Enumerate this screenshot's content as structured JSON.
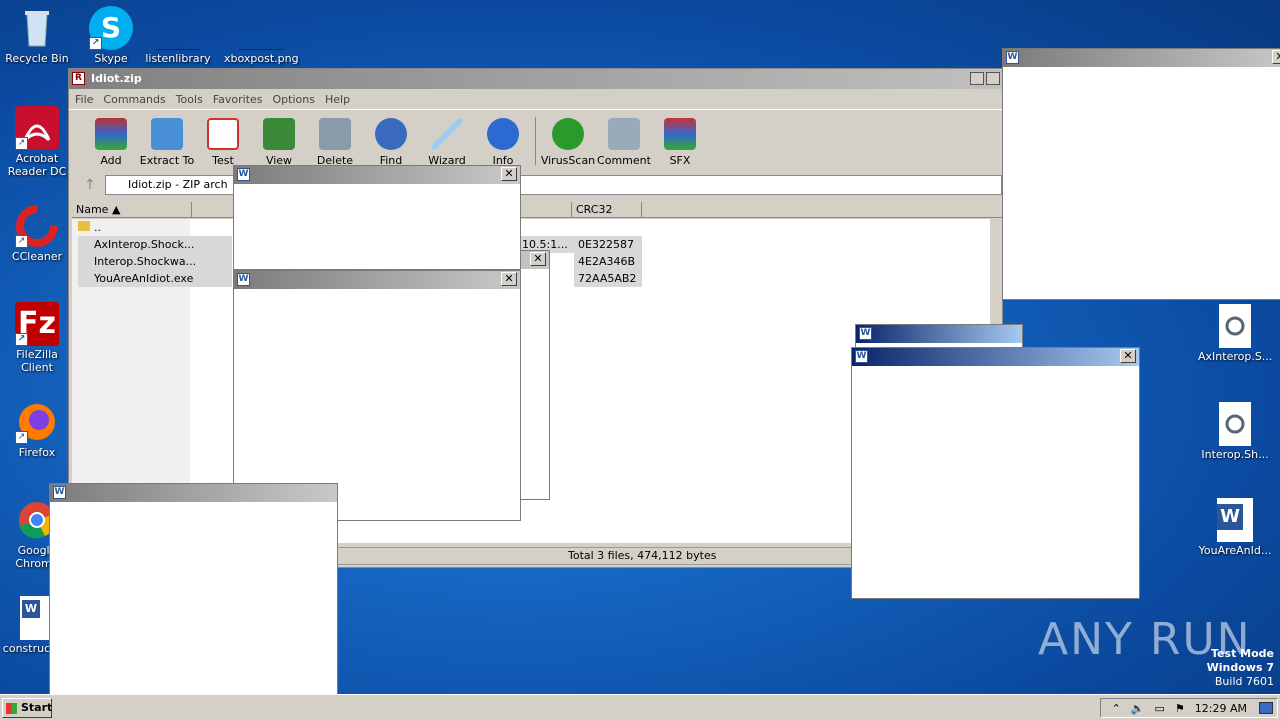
{
  "desktop": {
    "icons_left": [
      {
        "label": "Recycle Bin",
        "icon": "recycle-bin-icon"
      },
      {
        "label": "Acrobat Reader DC",
        "icon": "acrobat-icon"
      },
      {
        "label": "CCleaner",
        "icon": "ccleaner-icon"
      },
      {
        "label": "FileZilla Client",
        "icon": "filezilla-icon"
      },
      {
        "label": "Firefox",
        "icon": "firefox-icon"
      },
      {
        "label": "Google Chrome",
        "icon": "chrome-icon"
      },
      {
        "label": "construction",
        "icon": "word-doc-icon"
      }
    ],
    "icons_top": [
      {
        "label": "Skype",
        "icon": "skype-icon"
      },
      {
        "label": "listenlibrary",
        "icon": "file-icon"
      },
      {
        "label": "xboxpost.png",
        "icon": "image-icon"
      }
    ],
    "icons_right": [
      {
        "label": "AxInterop.S...",
        "icon": "dll-icon"
      },
      {
        "label": "Interop.Sh...",
        "icon": "dll-icon"
      },
      {
        "label": "YouAreAnId...",
        "icon": "word-icon"
      }
    ]
  },
  "winrar": {
    "title": "Idiot.zip",
    "menu": [
      "File",
      "Commands",
      "Tools",
      "Favorites",
      "Options",
      "Help"
    ],
    "toolbar": [
      "Add",
      "Extract To",
      "Test",
      "View",
      "Delete",
      "Find",
      "Wizard",
      "Info",
      "VirusScan",
      "Comment",
      "SFX"
    ],
    "address": "Idiot.zip - ZIP arch",
    "columns": [
      "Name",
      "CRC32"
    ],
    "rows": [
      {
        "name": "..",
        "modified": "",
        "crc": ""
      },
      {
        "name": "AxInterop.Shock...",
        "modified": "10.5:1...",
        "crc": "0E322587"
      },
      {
        "name": "Interop.Shockwa...",
        "modified": "",
        "crc": "4E2A346B"
      },
      {
        "name": "YouAreAnIdiot.exe",
        "modified": "",
        "crc": "72AA5AB2"
      }
    ],
    "status": "Total 3 files, 474,112 bytes"
  },
  "popup_close": "✕",
  "taskbar": {
    "start": "Start",
    "clock": "12:29 AM"
  },
  "watermark": {
    "line1": "Test Mode",
    "line2": "Windows 7",
    "line3": "Build 7601",
    "brand": "ANY RUN"
  }
}
